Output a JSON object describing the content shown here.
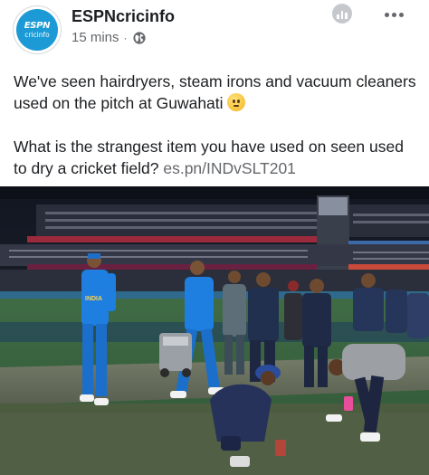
{
  "post": {
    "page_name": "ESPNcricinfo",
    "timestamp": "15 mins",
    "separator": "·",
    "privacy_icon": "globe-icon",
    "menu_icon": "more-options-icon",
    "insights_icon": "stats-icon",
    "avatar": {
      "logo_top": "ESPN",
      "logo_bottom": "cricinfo",
      "color": "#1c9ad6"
    },
    "text_paragraph_1": "We've seen hairdryers, steam irons and vacuum cleaners used on the pitch at Guwahati",
    "emoji": "confused-face-emoji",
    "text_paragraph_2": "What is the strangest item you have used on seen used to dry a cricket field?",
    "link": "es.pn/INDvSLT201"
  },
  "photo": {
    "subject": "cricket-pitch-drying-photo",
    "jersey_text": "INDIA"
  }
}
